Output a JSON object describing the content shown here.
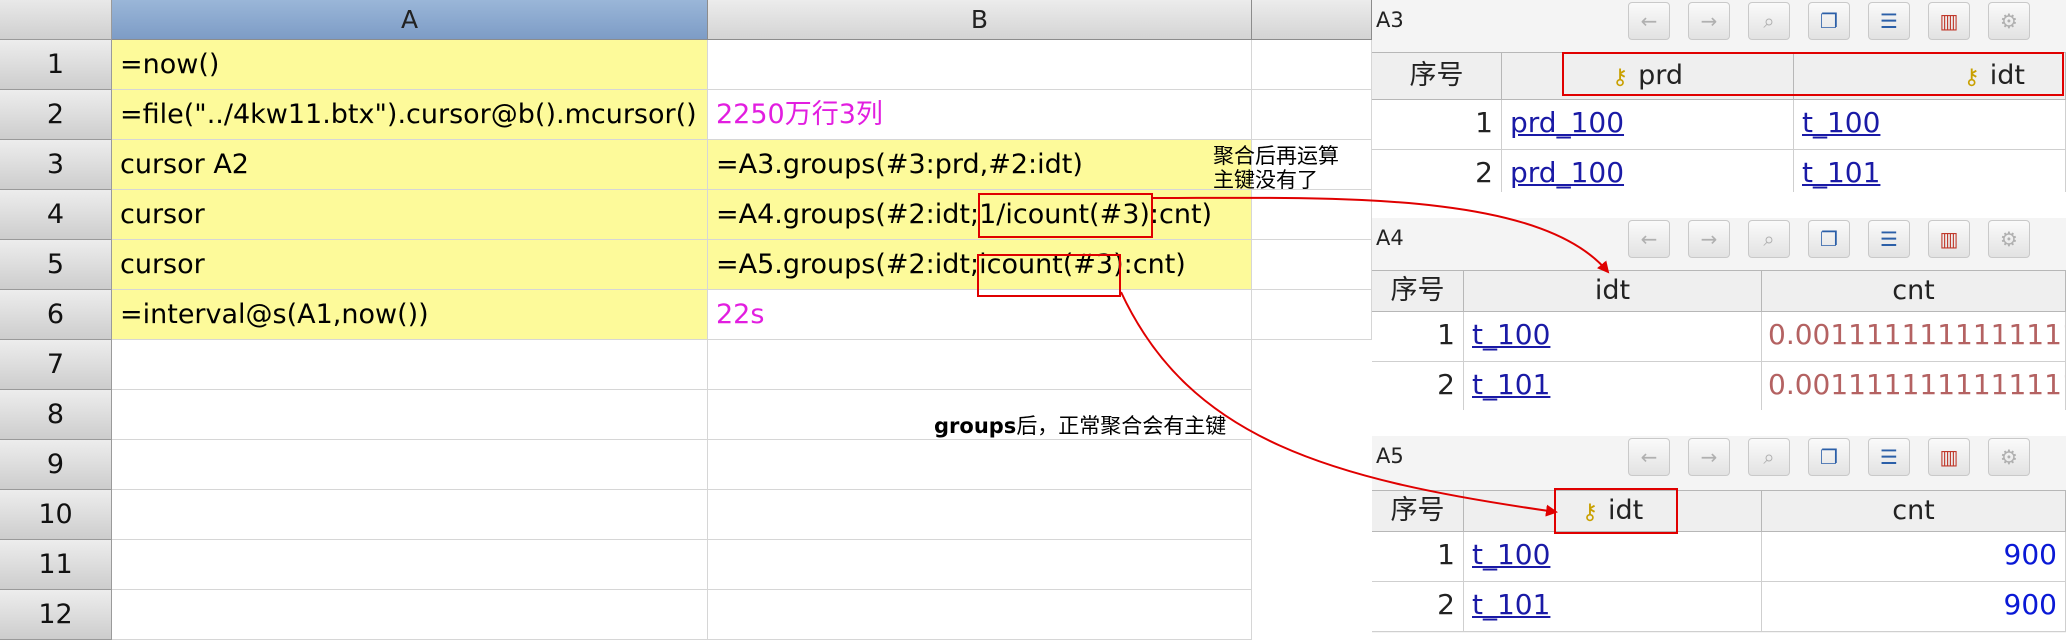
{
  "grid": {
    "col_headers": [
      "A",
      "B"
    ],
    "row_numbers": [
      "1",
      "2",
      "3",
      "4",
      "5",
      "6",
      "7",
      "8",
      "9",
      "10",
      "11",
      "12"
    ],
    "cells": {
      "A1": "=now()",
      "A2": "=file(\"../4kw11.btx\").cursor@b().mcursor()",
      "B2": "2250万行3列",
      "A3": "cursor A2",
      "B3": "=A3.groups(#3:prd,#2:idt)",
      "A4": "cursor",
      "B4_pre": "=A4.groups(#2:idt;",
      "B4_box": "1/icount(#3)",
      "B4_post": ":cnt)",
      "A5": "cursor",
      "B5_pre": "=A5.groups(#2:idt;",
      "B5_box": "icount(#3)",
      "B5_post": ":cnt)",
      "A6": "=interval@s(A1,now())",
      "B6": "22s"
    },
    "annotations": {
      "note1_line1": "聚合后再运算",
      "note1_line2": "主键没有了",
      "note2_bold": "groups",
      "note2_rest": "后，正常聚合会有主键"
    }
  },
  "panels": {
    "a3": {
      "title": "A3",
      "headers": [
        "序号",
        "prd",
        "idt"
      ],
      "rows": [
        {
          "no": "1",
          "prd": "prd_100",
          "idt": "t_100"
        },
        {
          "no": "2",
          "prd": "prd_100",
          "idt": "t_101"
        }
      ]
    },
    "a4": {
      "title": "A4",
      "headers": [
        "序号",
        "idt",
        "cnt"
      ],
      "rows": [
        {
          "no": "1",
          "idt": "t_100",
          "cnt": "0.0011111111111111"
        },
        {
          "no": "2",
          "idt": "t_101",
          "cnt": "0.0011111111111111"
        }
      ]
    },
    "a5": {
      "title": "A5",
      "headers": [
        "序号",
        "idt",
        "cnt"
      ],
      "rows": [
        {
          "no": "1",
          "idt": "t_100",
          "cnt": "900"
        },
        {
          "no": "2",
          "idt": "t_101",
          "cnt": "900"
        }
      ]
    },
    "toolbar_icons": [
      "back-arrow-icon",
      "forward-arrow-icon",
      "zoom-icon",
      "copy-icon",
      "list-icon",
      "chart-icon",
      "settings-icon"
    ]
  },
  "colors": {
    "formula_bg": "#fdfa9a",
    "value_text": "#e21ee0",
    "highlight": "#e00000",
    "link": "#1a1aa6",
    "cnt_blue": "#0a19d6",
    "cnt_red": "#b46262"
  }
}
